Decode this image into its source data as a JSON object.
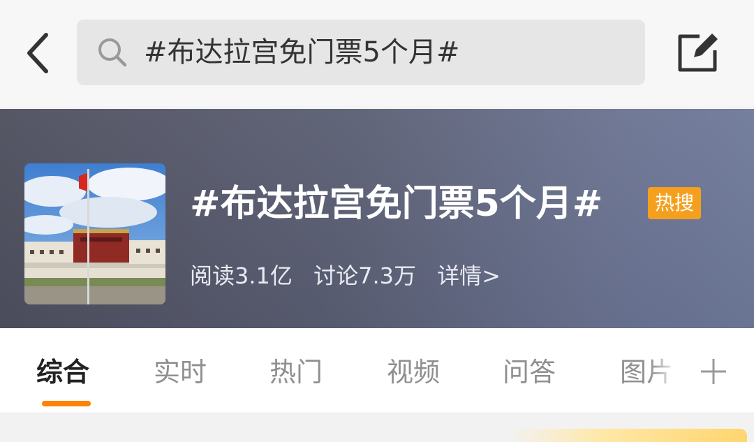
{
  "header": {
    "search_query": "#布达拉宫免门票5个月#",
    "icons": {
      "back": "chevron-left-icon",
      "search": "search-icon",
      "compose": "compose-icon"
    }
  },
  "topic": {
    "title": "#布达拉宫免门票5个月#",
    "badge": "热搜",
    "reads": "阅读3.1亿",
    "discussions": "讨论7.3万",
    "details_link": "详情>",
    "thumbnail": "potala-palace-photo"
  },
  "tabs": {
    "items": [
      {
        "label": "综合",
        "active": true
      },
      {
        "label": "实时"
      },
      {
        "label": "热门"
      },
      {
        "label": "视频"
      },
      {
        "label": "问答"
      },
      {
        "label": "图片"
      }
    ],
    "add_icon": "plus-icon"
  },
  "colors": {
    "accent": "#ff8200",
    "badge": "#f4a01e",
    "banner": "#5a5e73"
  }
}
